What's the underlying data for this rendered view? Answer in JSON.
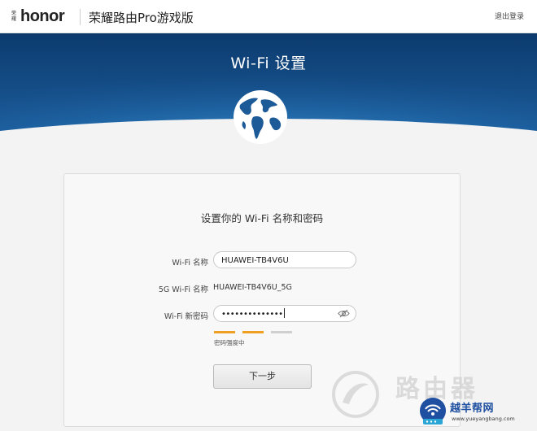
{
  "header": {
    "brand_cn": "荣耀",
    "brand": "honor",
    "product": "荣耀路由Pro游戏版",
    "logout": "退出登录"
  },
  "banner": {
    "title": "Wi-Fi 设置",
    "icon": "globe-icon"
  },
  "form": {
    "title": "设置你的 Wi-Fi 名称和密码",
    "wifi_name_label": "Wi-Fi 名称",
    "wifi_name_value": "HUAWEI-TB4V6U",
    "wifi5g_label": "5G Wi-Fi 名称",
    "wifi5g_value": "HUAWEI-TB4V6U_5G",
    "password_label": "Wi-Fi 新密码",
    "password_mask": "••••••••••••••",
    "strength_label": "密码强度中",
    "strength_level": 2,
    "strength_max": 3,
    "next_button": "下一步"
  },
  "watermark": {
    "large": "路由器",
    "site_name": "越羊帮网",
    "url": "www.yueyangbang.com"
  },
  "colors": {
    "banner_dark": "#0d3f73",
    "banner_light": "#2b80c4",
    "strength_active": "#f0a020",
    "strength_inactive": "#cfcfcf",
    "site_blue": "#1f4fa0"
  }
}
